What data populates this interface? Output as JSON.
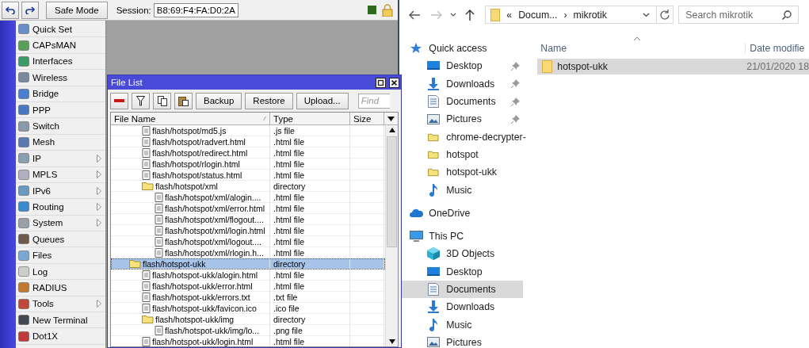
{
  "winbox": {
    "toolbar": {
      "safe_mode": "Safe Mode",
      "session_label": "Session:",
      "session_value": "B8:69:F4:FA:D0:2A"
    },
    "menu": [
      {
        "label": "Quick Set",
        "submenu": false
      },
      {
        "label": "CAPsMAN",
        "submenu": false
      },
      {
        "label": "Interfaces",
        "submenu": false
      },
      {
        "label": "Wireless",
        "submenu": false
      },
      {
        "label": "Bridge",
        "submenu": false
      },
      {
        "label": "PPP",
        "submenu": false
      },
      {
        "label": "Switch",
        "submenu": false
      },
      {
        "label": "Mesh",
        "submenu": false
      },
      {
        "label": "IP",
        "submenu": true
      },
      {
        "label": "MPLS",
        "submenu": true
      },
      {
        "label": "IPv6",
        "submenu": true
      },
      {
        "label": "Routing",
        "submenu": true
      },
      {
        "label": "System",
        "submenu": true
      },
      {
        "label": "Queues",
        "submenu": false
      },
      {
        "label": "Files",
        "submenu": false
      },
      {
        "label": "Log",
        "submenu": false
      },
      {
        "label": "RADIUS",
        "submenu": false
      },
      {
        "label": "Tools",
        "submenu": true
      },
      {
        "label": "New Terminal",
        "submenu": false
      },
      {
        "label": "Dot1X",
        "submenu": false
      }
    ],
    "file_list": {
      "title": "File List",
      "buttons": [
        "Backup",
        "Restore",
        "Upload..."
      ],
      "find_placeholder": "Find",
      "columns": [
        "File Name",
        "Type",
        "Size"
      ],
      "rows": [
        {
          "children": [
            {
              "name": "flash/hotspot/md5.js",
              "type": ".js file",
              "kind": "file",
              "selected": false
            },
            {
              "name": "flash/hotspot/radvert.html",
              "type": ".html file",
              "kind": "file",
              "selected": false
            },
            {
              "name": "flash/hotspot/redirect.html",
              "type": ".html file",
              "kind": "file",
              "selected": false
            },
            {
              "name": "flash/hotspot/rlogin.html",
              "type": ".html file",
              "kind": "file",
              "selected": false
            },
            {
              "name": "flash/hotspot/status.html",
              "type": ".html file",
              "kind": "file",
              "selected": false
            },
            {
              "name": "flash/hotspot/xml",
              "type": "directory",
              "kind": "folder",
              "selected": false,
              "children": [
                {
                  "name": "flash/hotspot/xml/alogin....",
                  "type": ".html file",
                  "kind": "file",
                  "selected": false
                },
                {
                  "name": "flash/hotspot/xml/error.html",
                  "type": ".html file",
                  "kind": "file",
                  "selected": false
                },
                {
                  "name": "flash/hotspot/xml/flogout....",
                  "type": ".html file",
                  "kind": "file",
                  "selected": false
                },
                {
                  "name": "flash/hotspot/xml/login.html",
                  "type": ".html file",
                  "kind": "file",
                  "selected": false
                },
                {
                  "name": "flash/hotspot/xml/logout....",
                  "type": ".html file",
                  "kind": "file",
                  "selected": false
                },
                {
                  "name": "flash/hotspot/xml/rlogin.h...",
                  "type": ".html file",
                  "kind": "file",
                  "selected": false
                }
              ]
            }
          ]
        },
        {
          "name": "flash/hotspot-ukk",
          "type": "directory",
          "kind": "folder",
          "selected": true,
          "children": [
            {
              "name": "flash/hotspot-ukk/alogin.html",
              "type": ".html file",
              "kind": "file",
              "selected": false
            },
            {
              "name": "flash/hotspot-ukk/error.html",
              "type": ".html file",
              "kind": "file",
              "selected": false
            },
            {
              "name": "flash/hotspot-ukk/errors.txt",
              "type": ".txt file",
              "kind": "file",
              "selected": false
            },
            {
              "name": "flash/hotspot-ukk/favicon.ico",
              "type": ".ico file",
              "kind": "file",
              "selected": false
            },
            {
              "name": "flash/hotspot-ukk/img",
              "type": "directory",
              "kind": "folder",
              "selected": false,
              "children": [
                {
                  "name": "flash/hotspot-ukk/img/lo...",
                  "type": ".png file",
                  "kind": "file",
                  "selected": false
                }
              ]
            },
            {
              "name": "flash/hotspot-ukk/login.html",
              "type": ".html file",
              "kind": "file",
              "selected": false
            }
          ]
        }
      ]
    }
  },
  "explorer": {
    "address": {
      "overflow": "«",
      "parent": "Docum...",
      "separator": "›",
      "current": "mikrotik"
    },
    "search_placeholder": "Search mikrotik",
    "nav": [
      {
        "label": "Quick access",
        "kind": "star",
        "selected": false,
        "children": [
          {
            "label": "Desktop",
            "kind": "desktop",
            "pinned": true,
            "selected": false
          },
          {
            "label": "Downloads",
            "kind": "download",
            "pinned": true,
            "selected": false
          },
          {
            "label": "Documents",
            "kind": "documents",
            "pinned": true,
            "selected": false
          },
          {
            "label": "Pictures",
            "kind": "pictures",
            "pinned": true,
            "selected": false
          },
          {
            "label": "chrome-decrypter-",
            "kind": "folder",
            "selected": false
          },
          {
            "label": "hotspot",
            "kind": "folder",
            "selected": false
          },
          {
            "label": "hotspot-ukk",
            "kind": "folder",
            "selected": false
          },
          {
            "label": "Music",
            "kind": "music",
            "selected": false
          }
        ]
      },
      {
        "label": "OneDrive",
        "kind": "cloud",
        "selected": false
      },
      {
        "label": "This PC",
        "kind": "pc",
        "selected": false,
        "children": [
          {
            "label": "3D Objects",
            "kind": "cube",
            "selected": false
          },
          {
            "label": "Desktop",
            "kind": "desktop",
            "selected": false
          },
          {
            "label": "Documents",
            "kind": "documents",
            "selected": true
          },
          {
            "label": "Downloads",
            "kind": "download",
            "selected": false
          },
          {
            "label": "Music",
            "kind": "music",
            "selected": false
          },
          {
            "label": "Pictures",
            "kind": "pictures",
            "selected": false
          }
        ]
      }
    ],
    "columns": [
      "Name",
      "Date modifie"
    ],
    "rows": [
      {
        "name": "hotspot-ukk",
        "date": "21/01/2020 18",
        "selected": true
      }
    ]
  }
}
